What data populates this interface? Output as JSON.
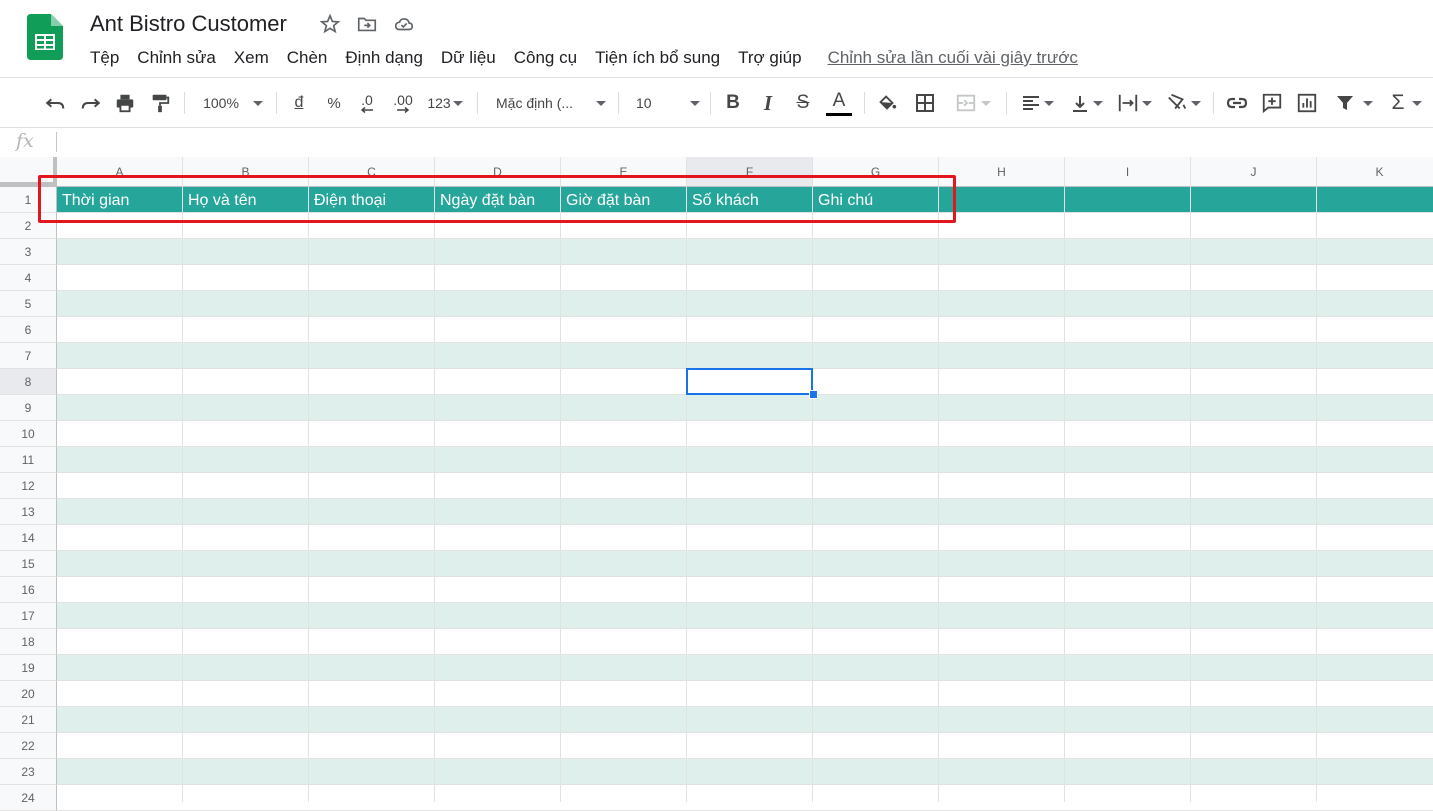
{
  "app": {
    "title": "Ant Bistro Customer",
    "icons": [
      "star-icon",
      "move-to-folder-icon",
      "cloud-status-icon"
    ],
    "brand_color": "#0f9d58"
  },
  "menu": {
    "items": [
      "Tệp",
      "Chỉnh sửa",
      "Xem",
      "Chèn",
      "Định dạng",
      "Dữ liệu",
      "Công cụ",
      "Tiện ích bổ sung",
      "Trợ giúp"
    ],
    "last_edit": "Chỉnh sửa lần cuối vài giây trước"
  },
  "toolbar": {
    "zoom": "100%",
    "currency": "đ",
    "percent": "%",
    "decrease_decimal": ".0",
    "increase_decimal": ".00",
    "more_formats": "123",
    "font": "Mặc định (...",
    "font_size": "10",
    "bold": "B",
    "italic": "I",
    "strikethrough": "S",
    "text_color": "A",
    "sum": "Σ"
  },
  "formula_bar": {
    "fx": "fx",
    "value": ""
  },
  "sheet": {
    "columns": [
      "A",
      "B",
      "C",
      "D",
      "E",
      "F",
      "G",
      "H",
      "I",
      "J",
      "K"
    ],
    "rows": [
      "1",
      "2",
      "3",
      "4",
      "5",
      "6",
      "7",
      "8",
      "9",
      "10",
      "11",
      "12",
      "13",
      "14",
      "15",
      "16",
      "17",
      "18",
      "19",
      "20",
      "21",
      "22",
      "23",
      "24"
    ],
    "header_cells": [
      "Thời gian",
      "Họ và tên",
      "Điện thoại",
      "Ngày đặt bàn",
      "Giờ đặt bàn",
      "Số khách",
      "Ghi chú"
    ],
    "selected_cell": "F8",
    "header_color": "#26a69a",
    "band_color": "#dfefec",
    "annotation_color": "#e2161c"
  }
}
